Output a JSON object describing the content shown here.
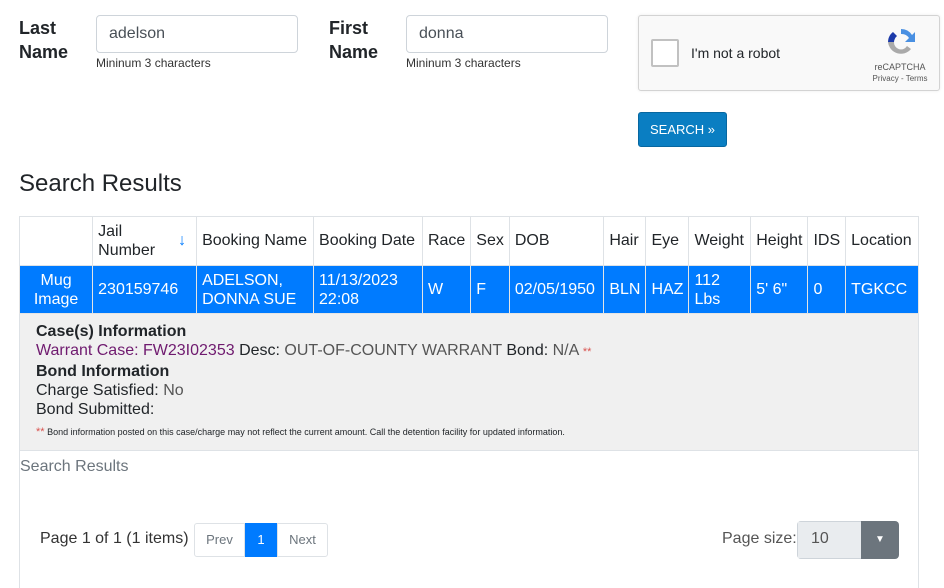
{
  "form": {
    "last_name_label": "Last Name",
    "last_name_value": "adelson",
    "first_name_label": "First Name",
    "first_name_value": "donna",
    "help": "Mininum 3 characters",
    "search_button": "SEARCH »"
  },
  "captcha": {
    "label": "I'm not a robot",
    "brand": "reCAPTCHA",
    "links": "Privacy - Terms"
  },
  "results": {
    "title": "Search Results",
    "columns": [
      "",
      "Jail Number",
      "Booking Name",
      "Booking Date",
      "Race",
      "Sex",
      "DOB",
      "Hair",
      "Eye",
      "Weight",
      "Height",
      "IDS",
      "Location"
    ],
    "row": {
      "mug": "Mug Image",
      "jail_number": "230159746",
      "booking_name": "ADELSON, DONNA SUE",
      "booking_date": "11/13/2023 22:08",
      "race": "W",
      "sex": "F",
      "dob": "02/05/1950",
      "hair": "BLN",
      "eye": "HAZ",
      "weight": "112 Lbs",
      "height": "5' 6\"",
      "ids": "0",
      "location": "TGKCC"
    },
    "details": {
      "case_heading": "Case(s) Information",
      "warrant_label": "Warrant Case:",
      "warrant_value": "FW23I02353",
      "desc_label": "Desc:",
      "desc_value": "OUT-OF-COUNTY WARRANT",
      "bond_label": "Bond:",
      "bond_value": "N/A",
      "stars": "**",
      "bond_heading": "Bond Information",
      "charge_label": "Charge Satisfied:",
      "charge_value": "No",
      "submitted_label": "Bond Submitted:",
      "note": "Bond information posted on this case/charge may not reflect the current amount. Call the detention facility for updated information."
    },
    "caption": "Search Results"
  },
  "pager": {
    "summary": "Page 1 of 1 (1 items)",
    "prev": "Prev",
    "current": "1",
    "next": "Next",
    "page_size_label": "Page size:",
    "page_size": "10"
  },
  "colors": {
    "selected_row": "#007bff",
    "search_button": "#0a7ec2"
  }
}
